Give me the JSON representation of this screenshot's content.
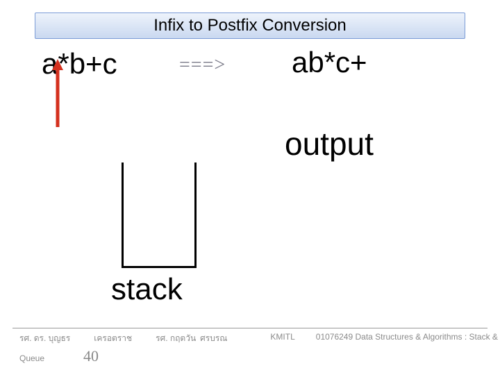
{
  "title": "Infix to Postfix Conversion",
  "infix_expr": "a*b+c",
  "arrow_symbol": "===>",
  "postfix_expr": "ab*c+",
  "output_label": "output",
  "stack_label": "stack",
  "footer": {
    "author1a": "รศ. ดร. บุญธร",
    "author1b": "เครอตราช",
    "author2a": "รศ. กฤตวัน",
    "author2b": "ศรบรณ",
    "inst": "KMITL",
    "course": "01076249 Data Structures & Algorithms : Stack &",
    "queue": "Queue",
    "page": "40"
  },
  "colors": {
    "arrow_red": "#d4301e",
    "title_border": "#7a9bd6"
  }
}
